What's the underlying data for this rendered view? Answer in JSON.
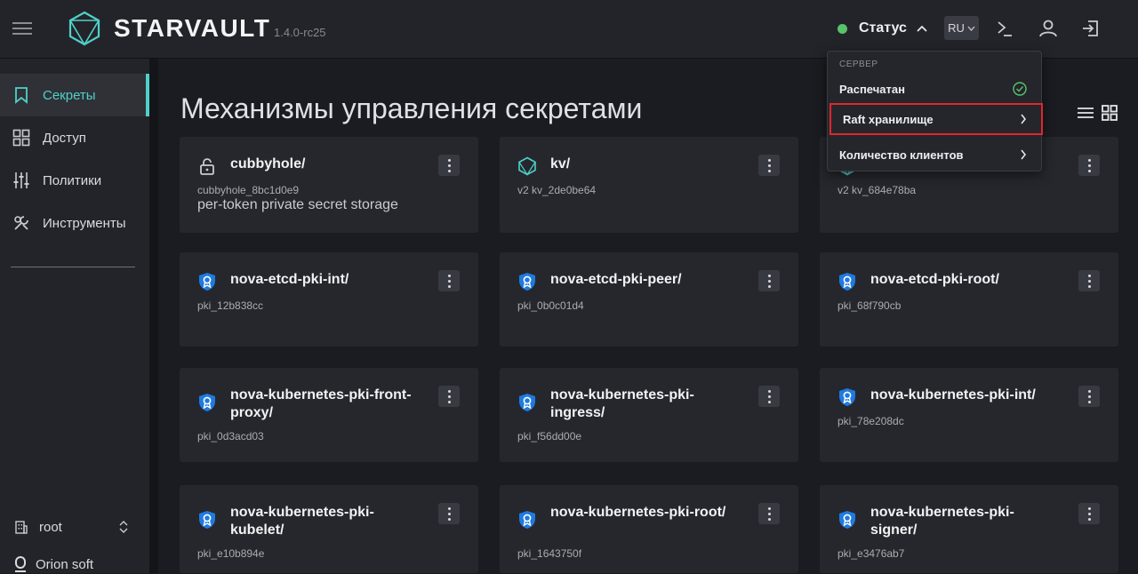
{
  "header": {
    "brand": "STARVAULT",
    "version": "1.4.0-rc25",
    "status_label": "Статус",
    "status_color": "#57c46a",
    "lang": "RU",
    "accent": "#4fd1c9"
  },
  "sidebar": {
    "items": [
      {
        "label": "Секреты",
        "icon": "bookmark-icon",
        "active": true
      },
      {
        "label": "Доступ",
        "icon": "grid-icon"
      },
      {
        "label": "Политики",
        "icon": "sliders-icon"
      },
      {
        "label": "Инструменты",
        "icon": "tools-icon"
      }
    ],
    "namespace": "root",
    "org": "Orion soft"
  },
  "main": {
    "title": "Механизмы управления секретами",
    "cards": [
      {
        "name": "cubbyhole/",
        "id": "cubbyhole_8bc1d0e9",
        "desc": "per-token private secret storage",
        "icon": "lock-icon"
      },
      {
        "name": "kv/",
        "id": "v2 kv_2de0be64",
        "icon": "kv-icon"
      },
      {
        "name": "",
        "id": "v2 kv_684e78ba",
        "icon": "kv-icon"
      },
      {
        "name": "nova-etcd-pki-int/",
        "id": "pki_12b838cc",
        "icon": "pki-shield-icon"
      },
      {
        "name": "nova-etcd-pki-peer/",
        "id": "pki_0b0c01d4",
        "icon": "pki-shield-icon"
      },
      {
        "name": "nova-etcd-pki-root/",
        "id": "pki_68f790cb",
        "icon": "pki-shield-icon"
      },
      {
        "name": "nova-kubernetes-pki-front-proxy/",
        "id": "pki_0d3acd03",
        "icon": "pki-shield-icon"
      },
      {
        "name": "nova-kubernetes-pki-ingress/",
        "id": "pki_f56dd00e",
        "icon": "pki-shield-icon"
      },
      {
        "name": "nova-kubernetes-pki-int/",
        "id": "pki_78e208dc",
        "icon": "pki-shield-icon"
      },
      {
        "name": "nova-kubernetes-pki-kubelet/",
        "id": "pki_e10b894e",
        "icon": "pki-shield-icon"
      },
      {
        "name": "nova-kubernetes-pki-root/",
        "id": "pki_1643750f",
        "icon": "pki-shield-icon"
      },
      {
        "name": "nova-kubernetes-pki-signer/",
        "id": "pki_e3476ab7",
        "icon": "pki-shield-icon"
      }
    ]
  },
  "status_menu": {
    "header": "СЕРВЕР",
    "items": [
      {
        "label": "Распечатан",
        "icon": "check-circle-icon"
      },
      {
        "label": "Raft хранилище",
        "icon": "chevron-right-icon",
        "highlighted": true
      },
      {
        "label": "Количество клиентов",
        "icon": "chevron-right-icon"
      }
    ]
  }
}
